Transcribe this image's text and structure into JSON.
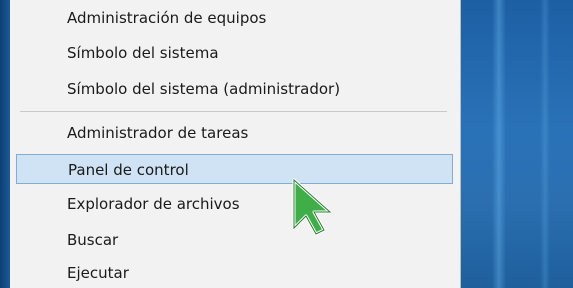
{
  "menu": {
    "items": [
      {
        "label": "Administración de equipos",
        "selected": false
      },
      {
        "label": "Símbolo del sistema",
        "selected": false
      },
      {
        "label": "Símbolo del sistema (administrador)",
        "selected": false
      },
      {
        "label": "Administrador de tareas",
        "selected": false
      },
      {
        "label": "Panel de control",
        "selected": true
      },
      {
        "label": "Explorador de archivos",
        "selected": false
      },
      {
        "label": "Buscar",
        "selected": false
      },
      {
        "label": "Ejecutar",
        "selected": false
      }
    ]
  },
  "colors": {
    "menu_background": "#f2f2f2",
    "selection_fill": "#cfe3f5",
    "selection_border": "#84acd2",
    "desktop": "#2a72b8",
    "cursor_fill": "#3fae49"
  },
  "cursor": {
    "icon": "green-arrow-cursor-icon"
  }
}
